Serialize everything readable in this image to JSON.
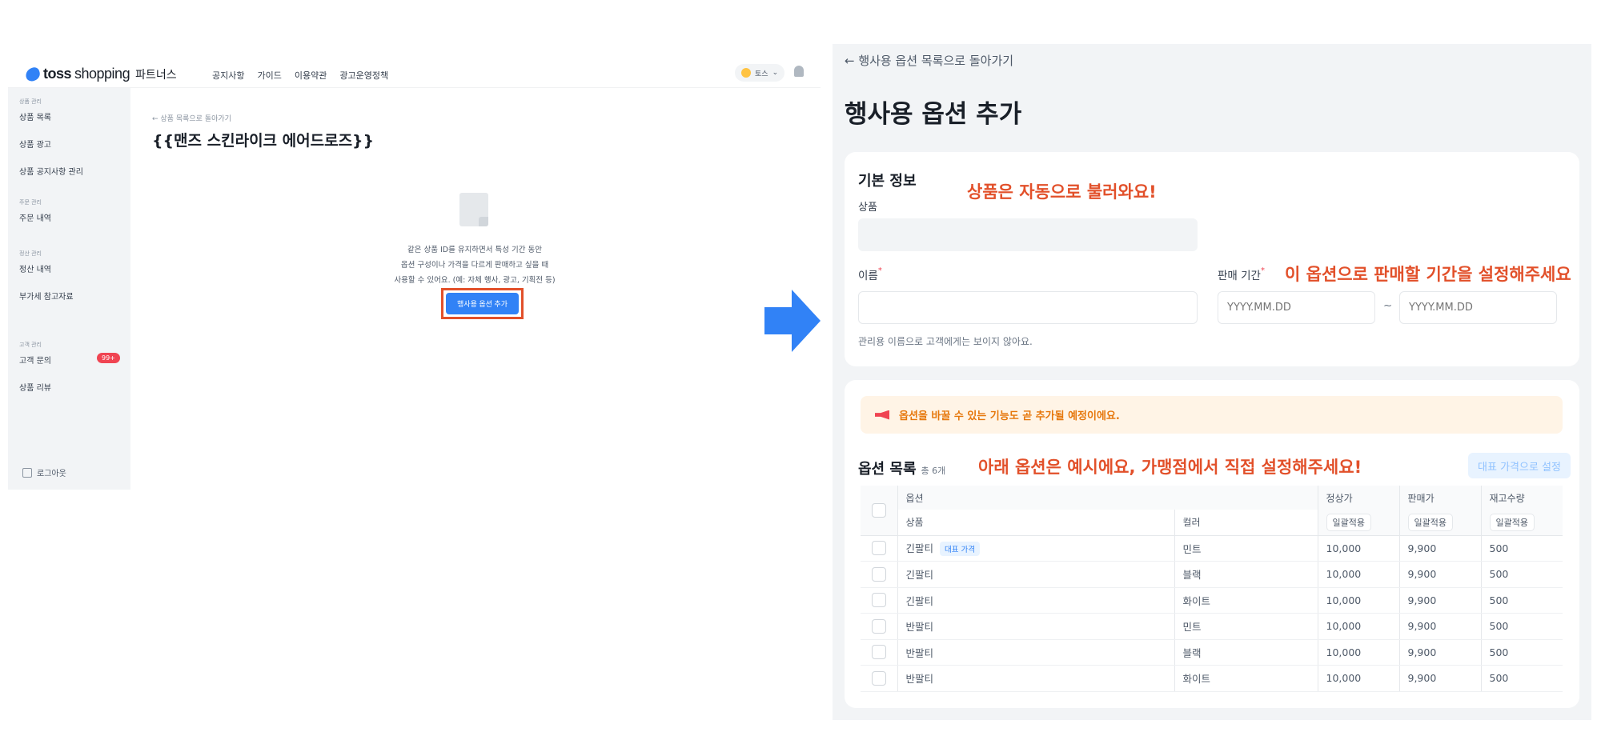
{
  "left": {
    "logo": {
      "brand": "toss",
      "product": "shopping",
      "suffix": "파트너스"
    },
    "topnav": [
      "공지사항",
      "가이드",
      "이용약관",
      "광고운영정책"
    ],
    "user": {
      "name": "토스"
    },
    "sidebar": {
      "groups": [
        {
          "title": "상품 관리",
          "items": [
            {
              "label": "상품 목록"
            },
            {
              "label": "상품 광고"
            },
            {
              "label": "상품 공지사항 관리"
            }
          ]
        },
        {
          "title": "주문 관리",
          "items": [
            {
              "label": "주문 내역"
            }
          ]
        },
        {
          "title": "정산 관리",
          "items": [
            {
              "label": "정산 내역"
            },
            {
              "label": "부가세 참고자료"
            }
          ]
        },
        {
          "title": "고객 관리",
          "items": [
            {
              "label": "고객 문의",
              "badge": "99+"
            },
            {
              "label": "상품 리뷰"
            }
          ]
        }
      ],
      "logout": "로그아웃"
    },
    "main": {
      "back": "← 상품 목록으로 돌아가기",
      "title": "{{맨즈 스킨라이크 에어드로즈}}",
      "empty_lines": [
        "같은 상품 ID를 유지하면서 특성 기간 동안",
        "옵션 구성이나 가격을 다르게 판매하고 싶을 때",
        "사용할 수 있어요. (예: 자체 행사, 광고, 기획전 등)"
      ],
      "add_button": "행사용 옵션 추가"
    }
  },
  "right": {
    "back": "← 행사용 옵션 목록으로 돌아가기",
    "title": "행사용 옵션 추가",
    "basic": {
      "title": "기본 정보",
      "product_label": "상품",
      "name_label": "이름",
      "period_label": "판매 기간",
      "date_placeholder": "YYYY.MM.DD",
      "tilde": "~",
      "help": "관리용 이름으로 고객에게는 보이지 않아요."
    },
    "annotations": {
      "auto": "상품은 자동으로 불러와요!",
      "period": "이 옵션으로 판매할 기간을 설정해주세요",
      "options": "아래 옵션은 예시에요, 가맹점에서 직접 설정해주세요!"
    },
    "options": {
      "notice": "옵션을 바꿀 수 있는 기능도 곧 추가될 예정이에요.",
      "title": "옵션 목록",
      "count": "총 6개",
      "rep_button": "대표 가격으로 설정",
      "headers": {
        "option": "옵션",
        "product": "상품",
        "color": "컬러",
        "regular": "정상가",
        "sale": "판매가",
        "stock": "재고수량",
        "bulk": "일괄적용"
      },
      "rep_tag": "대표 가격",
      "rows": [
        {
          "product": "긴팔티",
          "color": "민트",
          "regular": "10,000",
          "sale": "9,900",
          "stock": "500"
        },
        {
          "product": "긴팔티",
          "color": "블랙",
          "regular": "10,000",
          "sale": "9,900",
          "stock": "500"
        },
        {
          "product": "긴팔티",
          "color": "화이트",
          "regular": "10,000",
          "sale": "9,900",
          "stock": "500"
        },
        {
          "product": "반팔티",
          "color": "민트",
          "regular": "10,000",
          "sale": "9,900",
          "stock": "500"
        },
        {
          "product": "반팔티",
          "color": "블랙",
          "regular": "10,000",
          "sale": "9,900",
          "stock": "500"
        },
        {
          "product": "반팔티",
          "color": "화이트",
          "regular": "10,000",
          "sale": "9,900",
          "stock": "500"
        }
      ]
    }
  },
  "colors": {
    "accent": "#3182f6",
    "annotation": "#e2502a",
    "badge": "#f04452"
  }
}
